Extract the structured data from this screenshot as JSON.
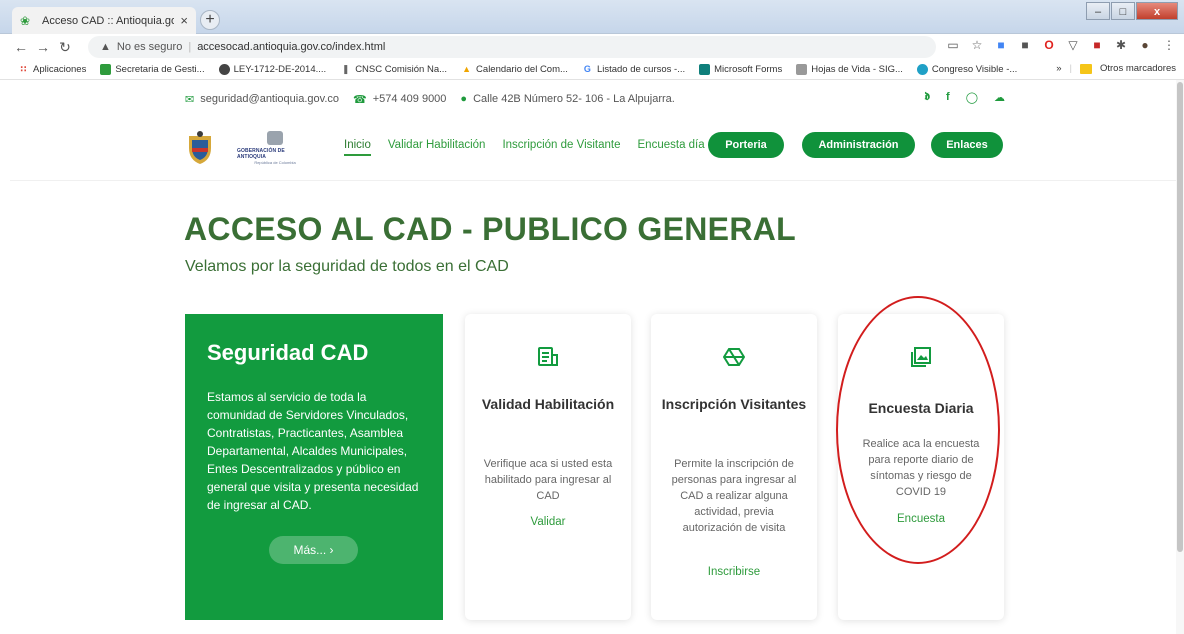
{
  "browser": {
    "tab_title": "Acceso CAD :: Antioquia.gov.co",
    "close_glyph": "×",
    "newtab_glyph": "+",
    "security_label": "No es seguro",
    "url": "accesocad.antioquia.gov.co/index.html",
    "bookmarks": [
      {
        "label": "Aplicaciones",
        "color": "#e0493b"
      },
      {
        "label": "Secretaria de Gesti...",
        "color": "#2e9b3c"
      },
      {
        "label": "LEY-1712-DE-2014....",
        "color": "#444444"
      },
      {
        "label": "CNSC Comisión Na...",
        "color": "#666666"
      },
      {
        "label": "Calendario del Com...",
        "color": "#f0a500"
      },
      {
        "label": "Listado de cursos -...",
        "color": "#4285f4"
      },
      {
        "label": "Microsoft Forms",
        "color": "#0f7f7b"
      },
      {
        "label": "Hojas de Vida - SIG...",
        "color": "#888888"
      },
      {
        "label": "Congreso Visible -...",
        "color": "#1fa0c6"
      }
    ],
    "more_bookmarks": "»",
    "other_bookmarks": "Otros marcadores"
  },
  "contact": {
    "email": "seguridad@antioquia.gov.co",
    "phone": "+574 409 9000",
    "address": "Calle 42B Número 52- 106 - La Alpujarra."
  },
  "social": [
    "twitter-icon",
    "facebook-icon",
    "instagram-icon",
    "soundcloud-icon"
  ],
  "logo": {
    "line1": "GOBERNACIÓN DE ANTIOQUIA",
    "line2": "República de Colombia"
  },
  "nav": {
    "items": [
      "Inicio",
      "Validar Habilitación",
      "Inscripción de Visitante",
      "Encuesta día"
    ],
    "buttons": [
      "Porteria",
      "Administración",
      "Enlaces"
    ]
  },
  "hero": {
    "title": "ACCESO AL CAD - PUBLICO GENERAL",
    "subtitle": "Velamos por la seguridad de todos en el CAD"
  },
  "feature": {
    "title": "Seguridad CAD",
    "text": "Estamos al servicio de toda la comunidad de Servidores Vinculados, Contratistas, Practicantes, Asamblea Departamental, Alcaldes Municipales, Entes Descentralizados y público en general que visita y presenta necesidad de ingresar al CAD.",
    "button": "Más... ›"
  },
  "cards": [
    {
      "title": "Validad Habilitación",
      "desc": "Verifique aca si usted esta habilitado para ingresar al CAD",
      "link": "Validar",
      "icon": "document-icon"
    },
    {
      "title": "Inscripción Visitantes",
      "desc": "Permite la inscripción de personas para ingresar al CAD a realizar alguna actividad, previa autorización de visita",
      "link": "Inscribirse",
      "icon": "hexagon-icon"
    },
    {
      "title": "Encuesta Diaria",
      "desc": "Realice aca la encuesta para reporte diario de síntomas y riesgo de COVID 19",
      "link": "Encuesta",
      "icon": "image-gallery-icon"
    }
  ],
  "colors": {
    "brand_green": "#129b3f",
    "title_green": "#3a6f35",
    "annotation_red": "#d21d1d"
  }
}
